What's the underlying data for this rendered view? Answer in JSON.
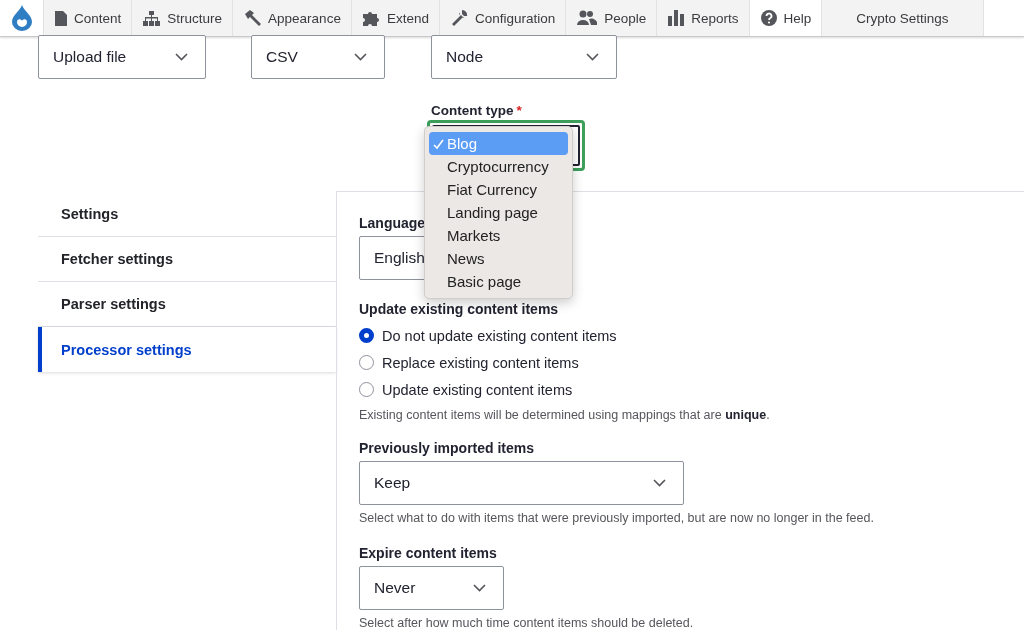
{
  "toolbar": {
    "items": [
      {
        "label": "Content",
        "selected": false
      },
      {
        "label": "Structure",
        "selected": false
      },
      {
        "label": "Appearance",
        "selected": false
      },
      {
        "label": "Extend",
        "selected": false
      },
      {
        "label": "Configuration",
        "selected": false
      },
      {
        "label": "People",
        "selected": false
      },
      {
        "label": "Reports",
        "selected": false
      },
      {
        "label": "Help",
        "selected": true
      },
      {
        "label": "Crypto Settings",
        "selected": false
      }
    ]
  },
  "top_selects": [
    {
      "value": "Upload file"
    },
    {
      "value": "CSV"
    },
    {
      "value": "Node"
    }
  ],
  "content_type": {
    "label": "Content type",
    "required_mark": "*",
    "focused": true,
    "menu": {
      "options": [
        {
          "label": "Blog",
          "selected": true
        },
        {
          "label": "Cryptocurrency",
          "selected": false
        },
        {
          "label": "Fiat Currency",
          "selected": false
        },
        {
          "label": "Landing page",
          "selected": false
        },
        {
          "label": "Markets",
          "selected": false
        },
        {
          "label": "News",
          "selected": false
        },
        {
          "label": "Basic page",
          "selected": false
        }
      ]
    }
  },
  "vertical_tabs": [
    {
      "label": "Settings",
      "selected": false
    },
    {
      "label": "Fetcher settings",
      "selected": false
    },
    {
      "label": "Parser settings",
      "selected": false
    },
    {
      "label": "Processor settings",
      "selected": true
    }
  ],
  "processor": {
    "language": {
      "label": "Language",
      "value": "English"
    },
    "update_existing": {
      "label": "Update existing content items",
      "options": [
        {
          "label": "Do not update existing content items",
          "checked": true
        },
        {
          "label": "Replace existing content items",
          "checked": false
        },
        {
          "label": "Update existing content items",
          "checked": false
        }
      ],
      "description": "Existing content items will be determined using mappings that are **unique**."
    },
    "previously_imported": {
      "label": "Previously imported items",
      "value": "Keep",
      "description": "Select what to do with items that were previously imported, but are now no longer in the feed."
    },
    "expire": {
      "label": "Expire content items",
      "value": "Never",
      "description": "Select after how much time content items should be deleted."
    }
  }
}
